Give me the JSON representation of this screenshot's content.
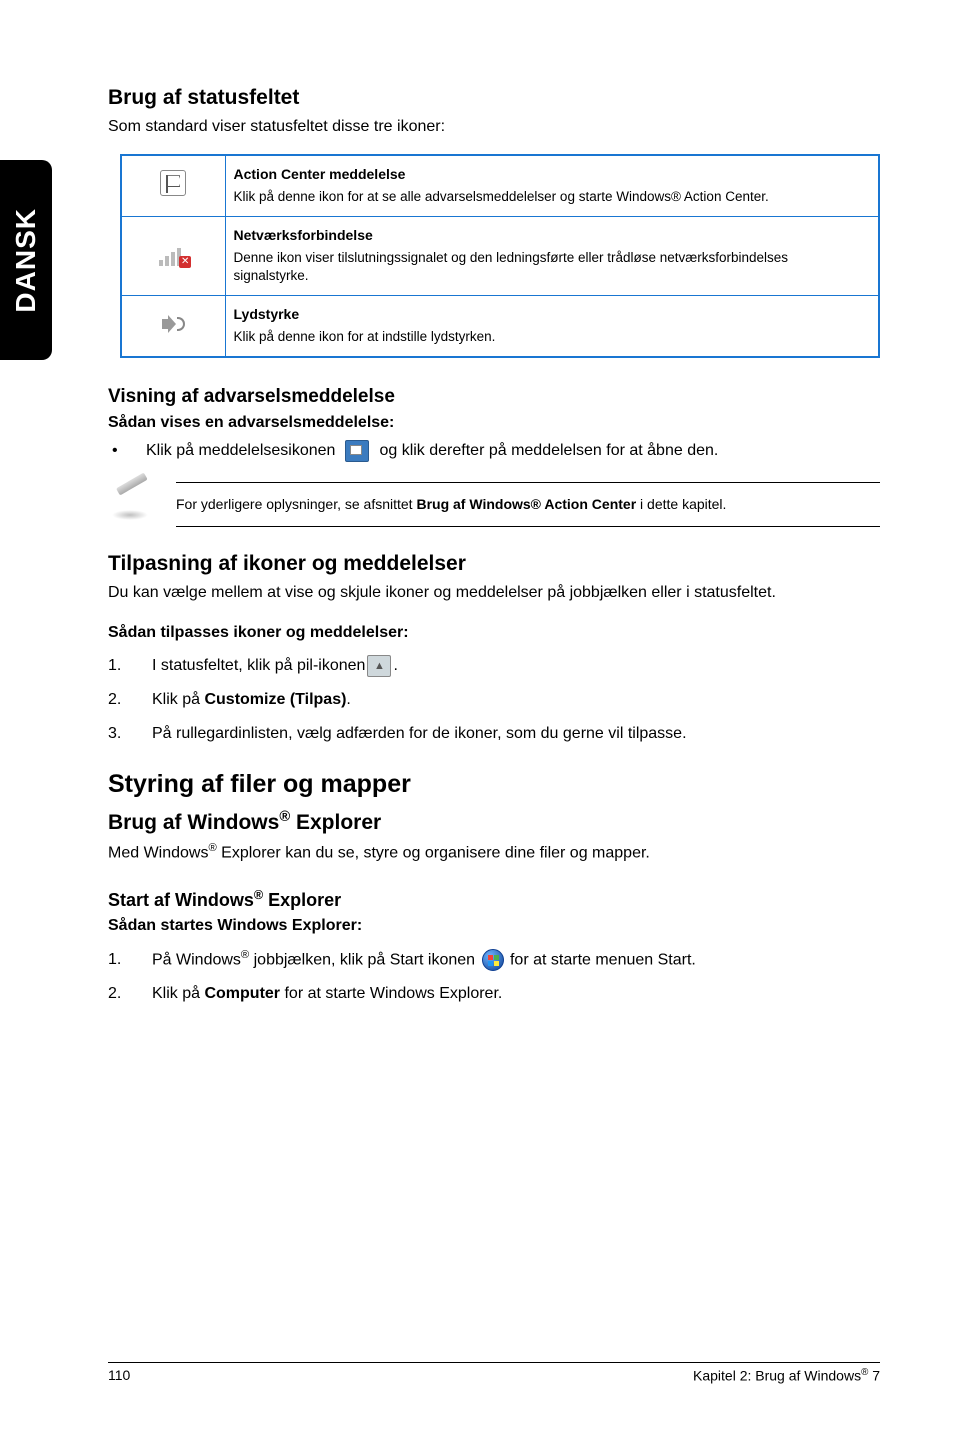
{
  "sideTab": "DANSK",
  "sec1": {
    "heading": "Brug af statusfeltet",
    "intro": "Som standard viser statusfeltet disse tre ikoner:"
  },
  "table": [
    {
      "title": "Action Center meddelelse",
      "desc": "Klik på denne ikon for at se alle advarselsmeddelelser og starte Windows® Action Center."
    },
    {
      "title": "Netværksforbindelse",
      "desc": "Denne ikon viser tilslutningssignalet og den ledningsførte eller trådløse netværksforbindelses signalstyrke."
    },
    {
      "title": "Lydstyrke",
      "desc": "Klik på denne ikon for at indstille lydstyrken."
    }
  ],
  "sec2": {
    "heading": "Visning af advarselsmeddelelse",
    "sub": "Sådan vises en advarselsmeddelelse:",
    "bullet_pre": "Klik på meddelelsesikonen",
    "bullet_post": "og klik derefter på meddelelsen for at åbne den."
  },
  "note": {
    "pre": "For yderligere oplysninger, se afsnittet ",
    "bold": "Brug af Windows® Action Center",
    "post": " i dette kapitel."
  },
  "sec3": {
    "heading": "Tilpasning af ikoner og meddelelser",
    "intro": "Du kan vælge mellem at vise og skjule ikoner og meddelelser på jobbjælken eller i statusfeltet.",
    "sub": "Sådan tilpasses ikoner og meddelelser:",
    "step1": "I statusfeltet, klik på pil-ikonen",
    "step1_end": ".",
    "step2_pre": "Klik på ",
    "step2_bold": "Customize (Tilpas)",
    "step2_post": ".",
    "step3": "På rullegardinlisten, vælg adfærden for de ikoner, som du gerne vil tilpasse."
  },
  "sec4": {
    "heading": "Styring af filer og mapper",
    "sub1_pre": "Brug af Windows",
    "sub1_post": " Explorer",
    "p1_pre": "Med Windows",
    "p1_post": " Explorer kan du se, styre og organisere dine filer og mapper.",
    "sub2_pre": "Start af Windows",
    "sub2_post": " Explorer",
    "sub3": "Sådan startes Windows Explorer:",
    "step1_pre": "På Windows",
    "step1_mid": " jobbjælken, klik på Start ikonen",
    "step1_post": "for at starte menuen Start.",
    "step2_pre": "Klik på ",
    "step2_bold": "Computer",
    "step2_post": " for at starte Windows Explorer."
  },
  "footer": {
    "page": "110",
    "chapter_pre": "Kapitel 2: Brug af Windows",
    "chapter_post": " 7"
  }
}
